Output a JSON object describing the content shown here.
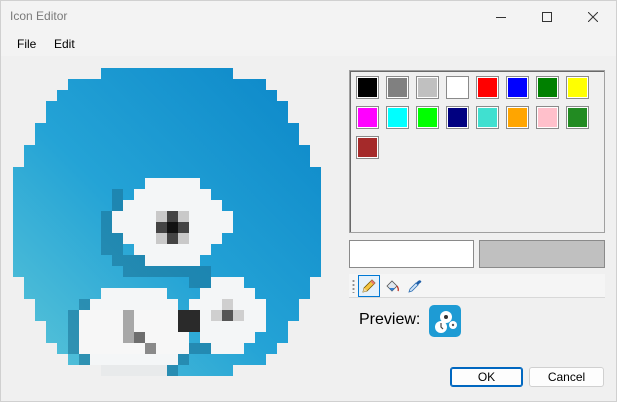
{
  "window": {
    "title": "Icon Editor"
  },
  "menu": {
    "file_label": "File",
    "edit_label": "Edit"
  },
  "palette": {
    "colors": [
      "#000000",
      "#808080",
      "#c0c0c0",
      "#ffffff",
      "#ff0000",
      "#0000ff",
      "#008000",
      "#ffff00",
      "#ff00ff",
      "#00ffff",
      "#00ff00",
      "#000080",
      "#40e0d0",
      "#ffa500",
      "#ffc0cb",
      "#228b22",
      "#a52a2a"
    ]
  },
  "colors": {
    "primary": "#ffffff",
    "secondary": "#c0c0c0",
    "icon_background": "#1e9bd4",
    "accent": "#0067c0"
  },
  "tools": {
    "items": [
      "pencil-icon",
      "fill-bucket-icon",
      "eyedropper-icon"
    ],
    "active": "pencil-icon"
  },
  "preview": {
    "label": "Preview:"
  },
  "buttons": {
    "ok_label": "OK",
    "cancel_label": "Cancel"
  }
}
